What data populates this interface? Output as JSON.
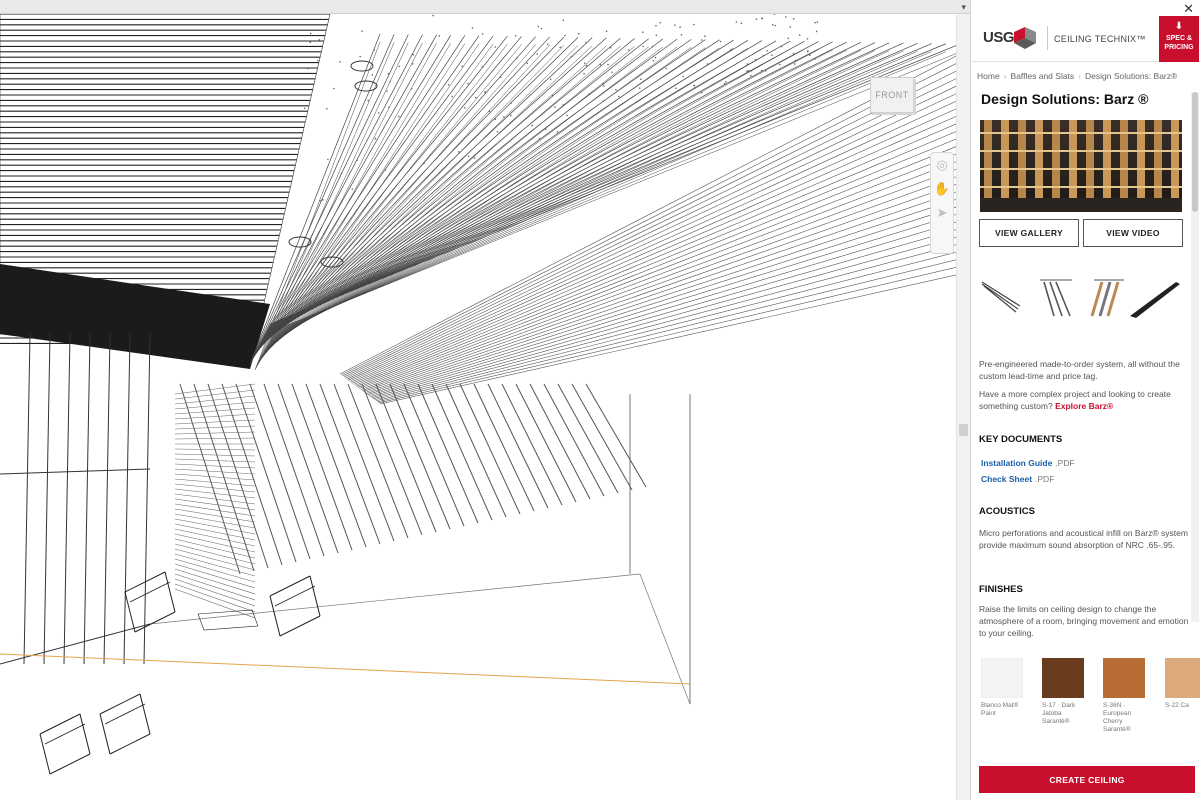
{
  "viewport": {
    "viewcube_label": "FRONT",
    "nav_icons": [
      "orbit-icon",
      "pan-icon",
      "walk-icon"
    ]
  },
  "panel": {
    "brand": "USG",
    "product_line": "CEILING TECHNIX™",
    "spec_button": "SPEC & PRICING",
    "breadcrumb": [
      "Home",
      "Baffles and Slats",
      "Design Solutions: Barz®"
    ],
    "title": "Design Solutions: Barz ®",
    "view_gallery": "VIEW GALLERY",
    "view_video": "VIEW VIDEO",
    "intro": "Pre-engineered made-to-order system, all without the custom lead-time and price tag.",
    "intro2": "Have a more complex project and looking to create something custom?",
    "explore_link": "Explore Barz®",
    "key_documents": {
      "heading": "KEY DOCUMENTS",
      "items": [
        {
          "name": "Installation Guide",
          "ext": ".PDF"
        },
        {
          "name": "Check Sheet",
          "ext": ".PDF"
        }
      ]
    },
    "acoustics": {
      "heading": "ACOUSTICS",
      "text": "Micro perforations and acoustical infill on Barz® system provide maximum sound absorption of NRC .65-.95."
    },
    "finishes": {
      "heading": "FINISHES",
      "text": "Raise the limits on ceiling design to change the atmosphere of a room, bringing movement and emotion to your ceiling.",
      "swatches": [
        {
          "label": "Blanco Mat® Paint",
          "color": "#f3f3f3"
        },
        {
          "label": "S-17 · Dark Jatoba Saranté®",
          "color": "#6a3c1e"
        },
        {
          "label": "S-36N · European Cherry Saranté®",
          "color": "#b76d33"
        },
        {
          "label": "S-22 Ca",
          "color": "#dcaa7c"
        }
      ]
    },
    "create_button": "CREATE CEILING",
    "colors": {
      "accent": "#c8102e",
      "link": "#1a5fa8"
    }
  }
}
